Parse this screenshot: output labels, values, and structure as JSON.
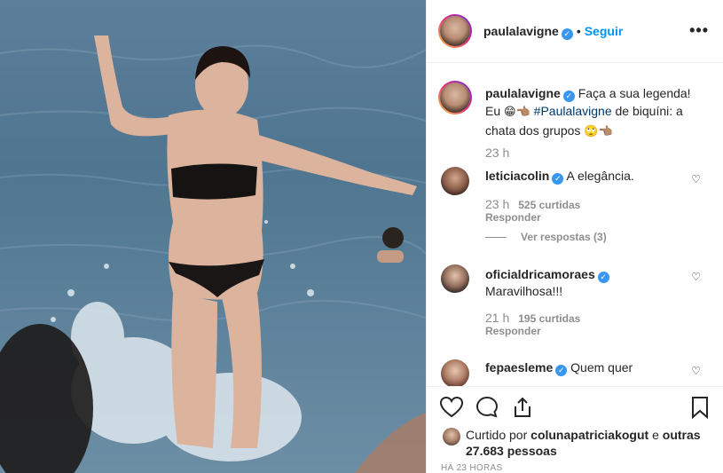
{
  "post": {
    "username": "paulalavigne",
    "follow_label": "Seguir",
    "separator": "•",
    "more_icon": "more-icon"
  },
  "caption": {
    "username": "paulalavigne",
    "text_part1": "Faça a sua legenda! Eu",
    "emoji1": "😁👈🏽",
    "hashtag": "#Paulalavigne",
    "text_part2": "de biquíni: a chata dos grupos",
    "emoji2": "🙄👈🏽",
    "time": "23 h"
  },
  "comments": [
    {
      "username": "leticiacolin",
      "text": "A elegância.",
      "time": "23 h",
      "likes": "525 curtidas",
      "reply": "Responder",
      "view_replies": "Ver respostas (3)"
    },
    {
      "username": "oficialdricamoraes",
      "text": "Maravilhosa!!!",
      "time": "21 h",
      "likes": "195 curtidas",
      "reply": "Responder"
    },
    {
      "username": "fepaesleme",
      "text": "Quem quer"
    }
  ],
  "actions": {
    "liked_prefix": "Curtido por",
    "liked_user": "colunapatriciakogut",
    "liked_and": "e",
    "liked_others": "outras 27.683 pessoas",
    "posted_time": "HÁ 23 HORAS"
  },
  "colors": {
    "accent": "#0095f6",
    "verified": "#3897f0",
    "muted": "#8e8e8e"
  }
}
